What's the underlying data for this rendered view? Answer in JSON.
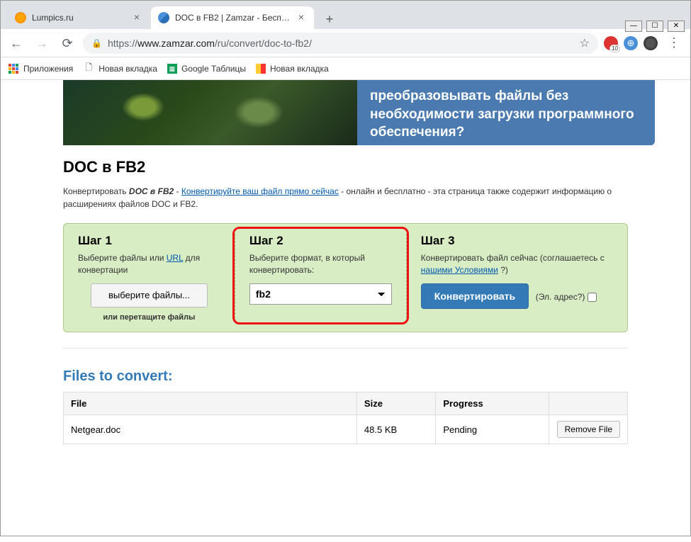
{
  "window": {
    "tabs": [
      {
        "title": "Lumpics.ru",
        "active": false
      },
      {
        "title": "DOC в FB2 | Zamzar - Бесплатна",
        "active": true
      }
    ],
    "url_proto": "https://",
    "url_host": "www.zamzar.com",
    "url_path": "/ru/convert/doc-to-fb2/",
    "ext_badge": "10"
  },
  "bookmarks": [
    {
      "label": "Приложения",
      "icon": "apps"
    },
    {
      "label": "Новая вкладка",
      "icon": "page"
    },
    {
      "label": "Google Таблицы",
      "icon": "sheets"
    },
    {
      "label": "Новая вкладка",
      "icon": "yandex"
    }
  ],
  "banner": {
    "text": "преобразовывать файлы без необходимости загрузки программного обеспечения?"
  },
  "heading": "DOC в FB2",
  "subtitle_pre": "Конвертировать ",
  "subtitle_strong": "DOC в FB2",
  "subtitle_sep": " - ",
  "subtitle_link": "Конвертируйте ваш файл прямо сейчас",
  "subtitle_post": " - онлайн и бесплатно - эта страница также содержит информацию о расширениях файлов DOC и FB2.",
  "steps": {
    "s1": {
      "title": "Шаг 1",
      "desc_pre": "Выберите файлы или ",
      "desc_link": "URL",
      "desc_post": " для конвертации",
      "choose_btn": "выберите файлы...",
      "drag_text": "или перетащите файлы"
    },
    "s2": {
      "title": "Шаг 2",
      "desc": "Выберите формат, в который конвертировать:",
      "selected": "fb2"
    },
    "s3": {
      "title": "Шаг 3",
      "desc_pre": "Конвертировать файл сейчас (соглашаетесь с ",
      "desc_link": "нашими Условиями",
      "desc_post": " ?)",
      "convert_btn": "Конвертировать",
      "email_label": "(Эл. адрес?)"
    }
  },
  "files": {
    "heading": "Files to convert:",
    "cols": {
      "file": "File",
      "size": "Size",
      "progress": "Progress"
    },
    "rows": [
      {
        "name": "Netgear.doc",
        "size": "48.5 KB",
        "progress": "Pending",
        "remove": "Remove File"
      }
    ]
  }
}
